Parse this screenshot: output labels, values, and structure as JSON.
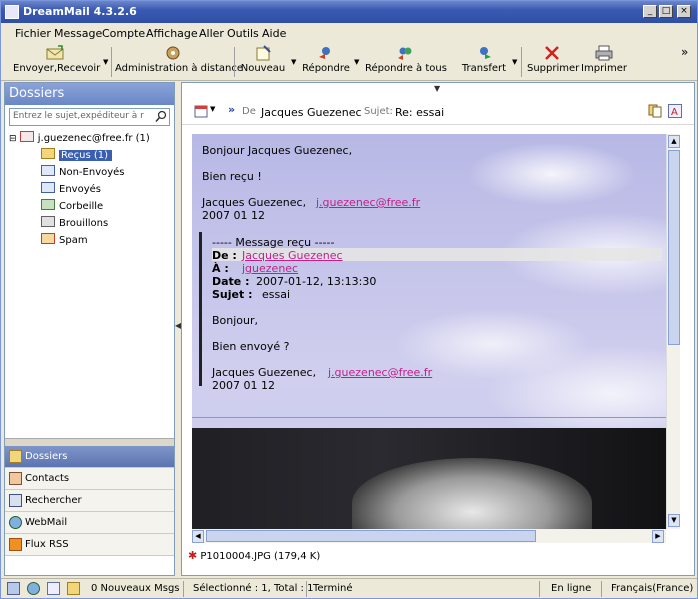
{
  "window": {
    "title": "DreamMail 4.3.2.6"
  },
  "menu": [
    "Fichier",
    "Message",
    "Compte",
    "Affichage",
    "Aller",
    "Outils",
    "Aide"
  ],
  "toolbar": {
    "send_receive": "Envoyer,Recevoir",
    "remote_admin": "Administration à distance",
    "new": "Nouveau",
    "reply": "Répondre",
    "reply_all": "Répondre à tous",
    "forward": "Transfert",
    "delete": "Supprimer",
    "print": "Imprimer",
    "more": "»"
  },
  "sidebar": {
    "header": "Dossiers",
    "search_placeholder": "Entrez le sujet,expéditeur à r",
    "account": "j.guezenec@free.fr (1)",
    "folders": [
      "Reçus (1)",
      "Non-Envoyés",
      "Envoyés",
      "Corbeille",
      "Brouillons",
      "Spam"
    ],
    "nav": [
      "Dossiers",
      "Contacts",
      "Rechercher",
      "WebMail",
      "Flux RSS"
    ]
  },
  "message": {
    "from_label": "De",
    "from": "Jacques Guezenec",
    "subject_label": "Sujet:",
    "subject": "Re: essai",
    "greeting": "Bonjour Jacques Guezenec,",
    "line1": "Bien reçu !",
    "sig_name": "Jacques Guezenec,",
    "sig_email": "j.guezenec@free.fr",
    "sig_date": "2007 01 12",
    "quote_header": "----- Message reçu -----",
    "q_from_label": "De :",
    "q_from": "Jacques Guezenec",
    "q_to_label": "À :",
    "q_to": "jguezenec",
    "q_date_label": "Date :",
    "q_date": "2007-01-12, 13:13:30",
    "q_subject_label": "Sujet :",
    "q_subject": "essai",
    "q_greeting": "Bonjour,",
    "q_line1": "Bien envoyé ?",
    "q_sig_name": "Jacques Guezenec,",
    "q_sig_email": "j.guezenec@free.fr",
    "q_sig_date": "2007 01 12",
    "attachment": "P1010004.JPG (179,4 K)"
  },
  "status": {
    "new_msgs": "0 Nouveaux Msgs",
    "selection": "Sélectionné : 1, Total : 1",
    "state": "Terminé",
    "online": "En ligne",
    "language": "Français(France)"
  }
}
